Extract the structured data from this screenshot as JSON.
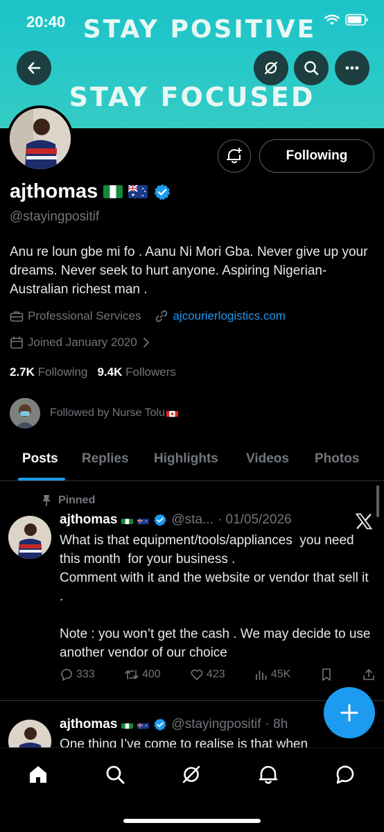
{
  "status_bar": {
    "time": "20:40"
  },
  "banner": {
    "line1": "STAY POSITIVE",
    "line2": "STAY FOCUSED"
  },
  "header_icons": {
    "back": "back-arrow-icon",
    "grok": "grok-icon",
    "search": "search-icon",
    "more": "more-icon"
  },
  "profile": {
    "name": "ajthomas",
    "handle": "@stayingpositif",
    "bio": "Anu re loun gbe mi fo . Aanu Ni Mori Gba. Never give up your dreams. Never seek to hurt anyone. Aspiring Nigerian-Australian richest man .",
    "category": "Professional Services",
    "website": "ajcourierlogistics.com",
    "joined": "Joined January 2020",
    "following_count": "2.7K",
    "following_label": "Following",
    "followers_count": "9.4K",
    "followers_label": "Followers",
    "followed_by": "Followed by Nurse Tolu",
    "follow_button": "Following"
  },
  "tabs": [
    {
      "label": "Posts",
      "active": true
    },
    {
      "label": "Replies",
      "active": false
    },
    {
      "label": "Highlights",
      "active": false
    },
    {
      "label": "Videos",
      "active": false
    },
    {
      "label": "Photos",
      "active": false
    }
  ],
  "posts": [
    {
      "pinned_label": "Pinned",
      "name": "ajthomas",
      "handle": "@sta...",
      "date": "· 01/05/2026",
      "text": "What is that equipment/tools/appliances  you need this month  for your business .\nComment with it and the website or vendor that sell it .\n\nNote : you won’t get the cash . We may decide to use another vendor of our choice",
      "replies": "333",
      "reposts": "400",
      "likes": "423",
      "views": "45K"
    },
    {
      "name": "ajthomas",
      "handle": "@stayingpositif",
      "date": "· 8h",
      "text": "One thing I’ve come to realise is that when"
    }
  ],
  "colors": {
    "accent": "#1d9bf0",
    "banner": "#22c5c7",
    "background": "#000000",
    "muted": "#71767b"
  }
}
